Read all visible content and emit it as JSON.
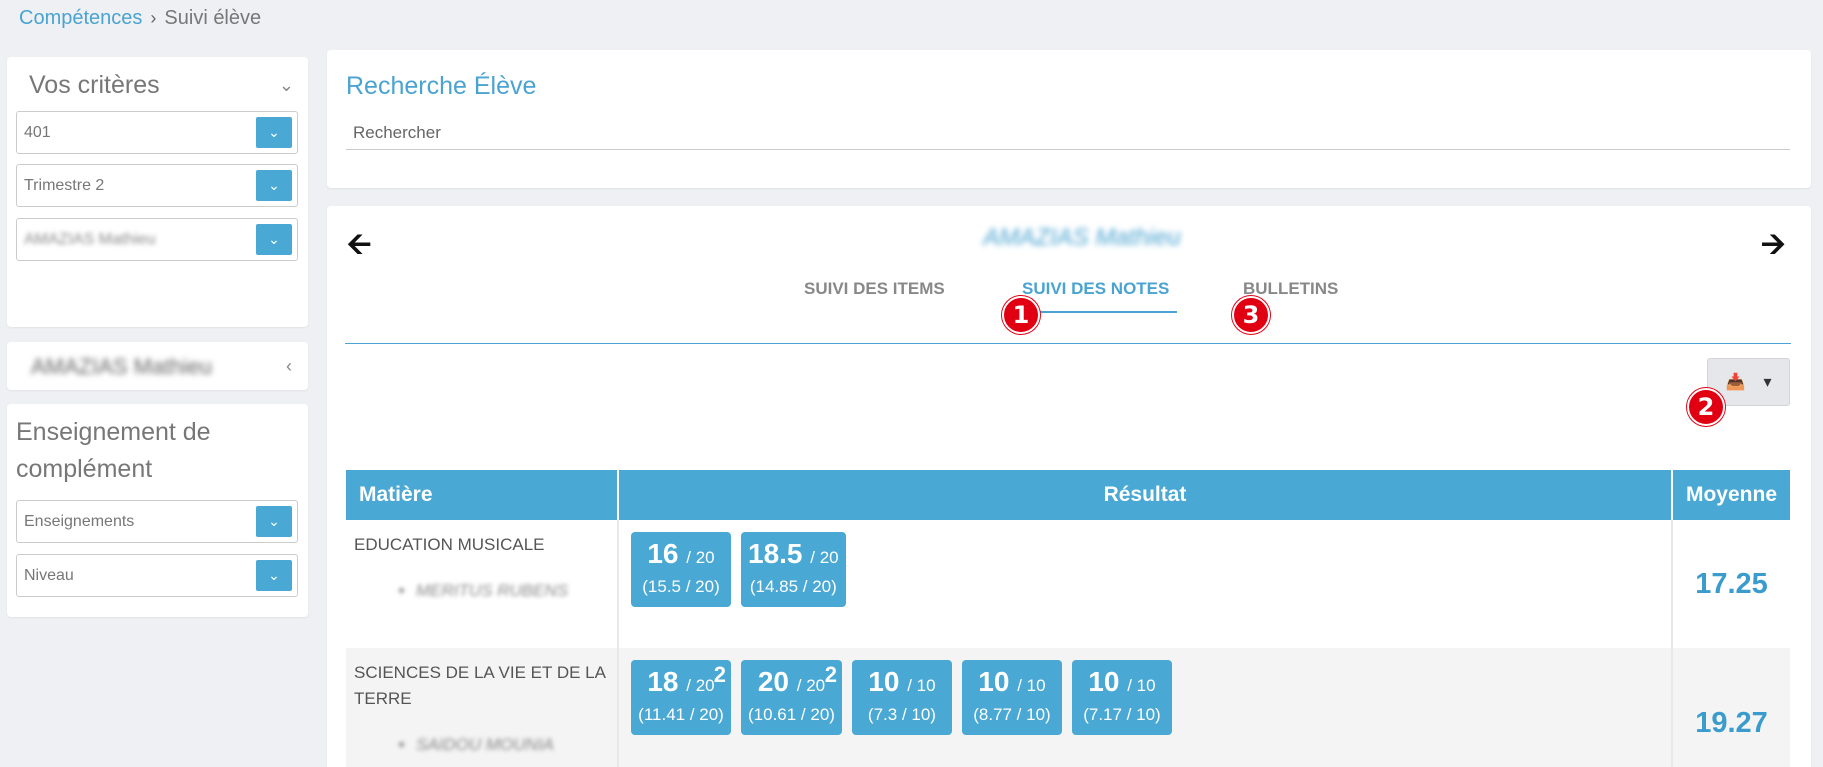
{
  "breadcrumb": {
    "parent": "Compétences",
    "separator": "›",
    "current": "Suivi élève"
  },
  "criteria": {
    "title": "Vos critères",
    "class_value": "401",
    "period_value": "Trimestre 2",
    "student_value": "AMAZIAS Mathieu"
  },
  "student_card": {
    "name": "AMAZIAS Mathieu"
  },
  "complement": {
    "title": "Enseignement de complément",
    "teaching_placeholder": "Enseignements",
    "level_placeholder": "Niveau"
  },
  "search": {
    "title": "Recherche Élève",
    "placeholder": "Rechercher"
  },
  "student": {
    "name": "AMAZIAS Mathieu"
  },
  "tabs": [
    {
      "label": "SUIVI DES ITEMS"
    },
    {
      "label": "SUIVI DES NOTES"
    },
    {
      "label": "BULLETINS"
    }
  ],
  "badges": [
    "1",
    "2",
    "3"
  ],
  "icons": {
    "prev": "arrow-left-icon",
    "next": "arrow-right-icon",
    "export": "download-icon",
    "caret": "caret-down-icon"
  },
  "table": {
    "headers": [
      "Matière",
      "Résultat",
      "Moyenne"
    ],
    "rows": [
      {
        "subject": "EDUCATION MUSICALE",
        "teacher": "MERITUS RUBENS",
        "grades": [
          {
            "score": "16",
            "out": "/ 20",
            "coef": "",
            "sub": "(15.5 / 20)"
          },
          {
            "score": "18.5",
            "out": "/ 20",
            "coef": "",
            "sub": "(14.85 / 20)"
          }
        ],
        "average": "17.25"
      },
      {
        "subject": "SCIENCES DE LA VIE ET DE LA TERRE",
        "teacher": "SAIDOU MOUNIA",
        "grades": [
          {
            "score": "18",
            "out": "/ 20",
            "coef": "2",
            "sub": "(11.41 / 20)"
          },
          {
            "score": "20",
            "out": "/ 20",
            "coef": "2",
            "sub": "(10.61 / 20)"
          },
          {
            "score": "10",
            "out": "/ 10",
            "coef": "",
            "sub": "(7.3 / 10)"
          },
          {
            "score": "10",
            "out": "/ 10",
            "coef": "",
            "sub": "(8.77 / 10)"
          },
          {
            "score": "10",
            "out": "/ 10",
            "coef": "",
            "sub": "(7.17 / 10)"
          }
        ],
        "average": "19.27"
      }
    ]
  },
  "colors": {
    "accent": "#4aa8d4",
    "badge": "#e00012"
  }
}
